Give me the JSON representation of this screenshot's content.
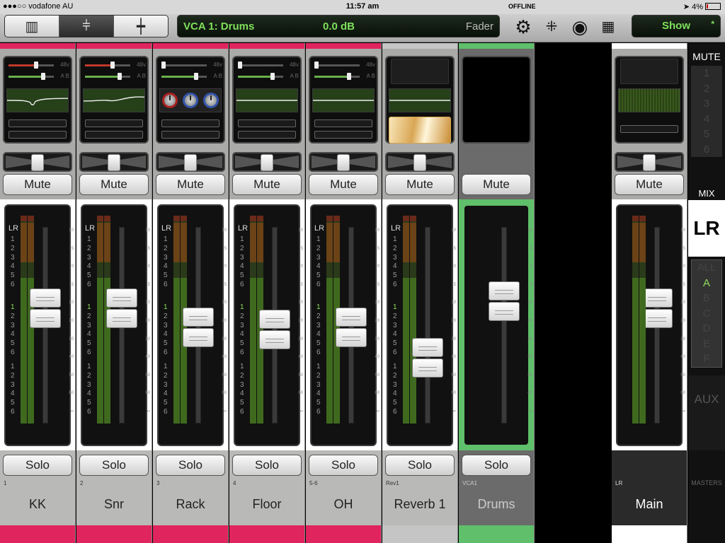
{
  "status": {
    "carrier": "●●●○○ vodafone AU",
    "time": "11:57 am",
    "offline": "OFFLINE",
    "battery": "4%"
  },
  "toolbar": {
    "seg": [
      "mixer-view",
      "faders-view",
      "single-channel-view"
    ],
    "vca_label": "VCA 1: Drums",
    "value": "0.0 dB",
    "mode": "Fader",
    "show": "Show",
    "show_mark": "*",
    "icons": [
      "gear-icon",
      "routing-grid-icon",
      "record-icon",
      "layout-icon"
    ]
  },
  "channels": [
    {
      "num": "1",
      "name": "KK",
      "mute": "Mute",
      "solo": "Solo",
      "color": "#e0245e",
      "proc": "eq",
      "level": 0.63,
      "meter": 0.7
    },
    {
      "num": "2",
      "name": "Snr",
      "mute": "Mute",
      "solo": "Solo",
      "color": "#e0245e",
      "proc": "eq2",
      "level": 0.63,
      "meter": 0.7
    },
    {
      "num": "3",
      "name": "Rack",
      "mute": "Mute",
      "solo": "Solo",
      "color": "#e0245e",
      "proc": "knobs",
      "level": 0.52,
      "meter": 0.7
    },
    {
      "num": "4",
      "name": "Floor",
      "mute": "Mute",
      "solo": "Solo",
      "color": "#e0245e",
      "proc": "flat",
      "level": 0.51,
      "meter": 0.7
    },
    {
      "num": "5-6",
      "name": "OH",
      "mute": "Mute",
      "solo": "Solo",
      "color": "#e0245e",
      "proc": "flat",
      "level": 0.52,
      "meter": 0.7
    },
    {
      "num": "Rev1",
      "name": "Reverb 1",
      "mute": "Mute",
      "solo": "Solo",
      "color": "#c5c5c5",
      "proc": "fx",
      "level": 0.35,
      "meter": 0.7
    },
    {
      "num": "VCA1",
      "name": "Drums",
      "mute": "Mute",
      "solo": "Solo",
      "color": "#5fbf6a",
      "proc": "vca",
      "level": 0.67,
      "meter": 0
    }
  ],
  "main": {
    "num": "LR",
    "name": "Main",
    "mute": "Mute",
    "level": 0.63
  },
  "right_panel": {
    "mute": "MUTE",
    "mute_groups": [
      "1",
      "2",
      "3",
      "4",
      "5",
      "6"
    ],
    "mix": "MIX",
    "lr": "LR",
    "vca_groups": [
      "ALL",
      "A",
      "B",
      "C",
      "D",
      "E",
      "F"
    ],
    "aux": "AUX",
    "masters": "MASTERS"
  },
  "meter_labels": [
    "1",
    "2",
    "3",
    "4",
    "5",
    "6"
  ],
  "scale_labels": [
    "10",
    "5",
    "0",
    "5",
    "10",
    "20",
    "30",
    "40",
    "50",
    "60",
    "∞"
  ]
}
